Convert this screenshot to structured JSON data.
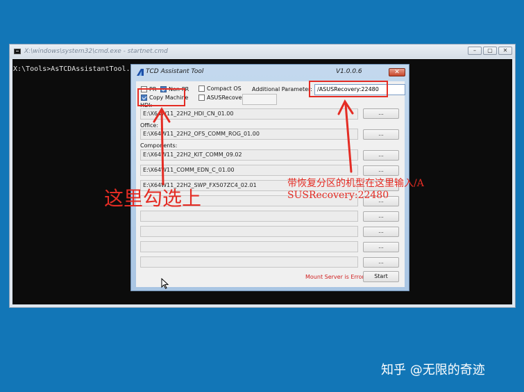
{
  "cmd": {
    "title": "X:\\windows\\system32\\cmd.exe - startnet.cmd",
    "buttons": [
      "–",
      "▢",
      "✕"
    ],
    "line": "X:\\Tools>AsTCDAssistantTool.e"
  },
  "tcd": {
    "title": "TCD Assistant Tool",
    "version": "V1.0.0.6",
    "close": "✕",
    "checkboxes": {
      "pr": {
        "label": "PR",
        "checked": false
      },
      "non_pr": {
        "label": "Non-PR",
        "checked": true
      },
      "copy_machine": {
        "label": "Copy Machine",
        "checked": true
      },
      "compact_os": {
        "label": "Compact OS",
        "checked": false
      },
      "asus_recovery": {
        "label": "ASUSRecovery:",
        "checked": false
      }
    },
    "additional_parameter_label": "Additional Parameter:",
    "additional_parameter_value": "/ASUSRecovery:22480",
    "hdi_label": "HDI:",
    "hdi_value": "E:\\X64W11_22H2_HDI_CN_01.00",
    "office_label": "Office:",
    "office_value": "E:\\X64W11_22H2_OFS_COMM_ROG_01.00",
    "components_label": "Components:",
    "components": [
      "E:\\X64W11_22H2_KIT_COMM_09.02",
      "E:\\X64W11_COMM_EDN_C_01.00",
      "E:\\X64W11_22H2_SWP_FX507ZC4_02.01",
      "",
      "",
      "",
      "",
      ""
    ],
    "browse_label": "...",
    "error_message": "Mount Server is Error!",
    "start_label": "Start"
  },
  "annotations": {
    "check_here": "这里勾选上",
    "input_here_line1": "带恢复分区的机型在这里输入/A",
    "input_here_line2": "SUSRecovery:22480",
    "color": "#e42c24"
  },
  "watermark": "知乎 @无限的奇迹"
}
